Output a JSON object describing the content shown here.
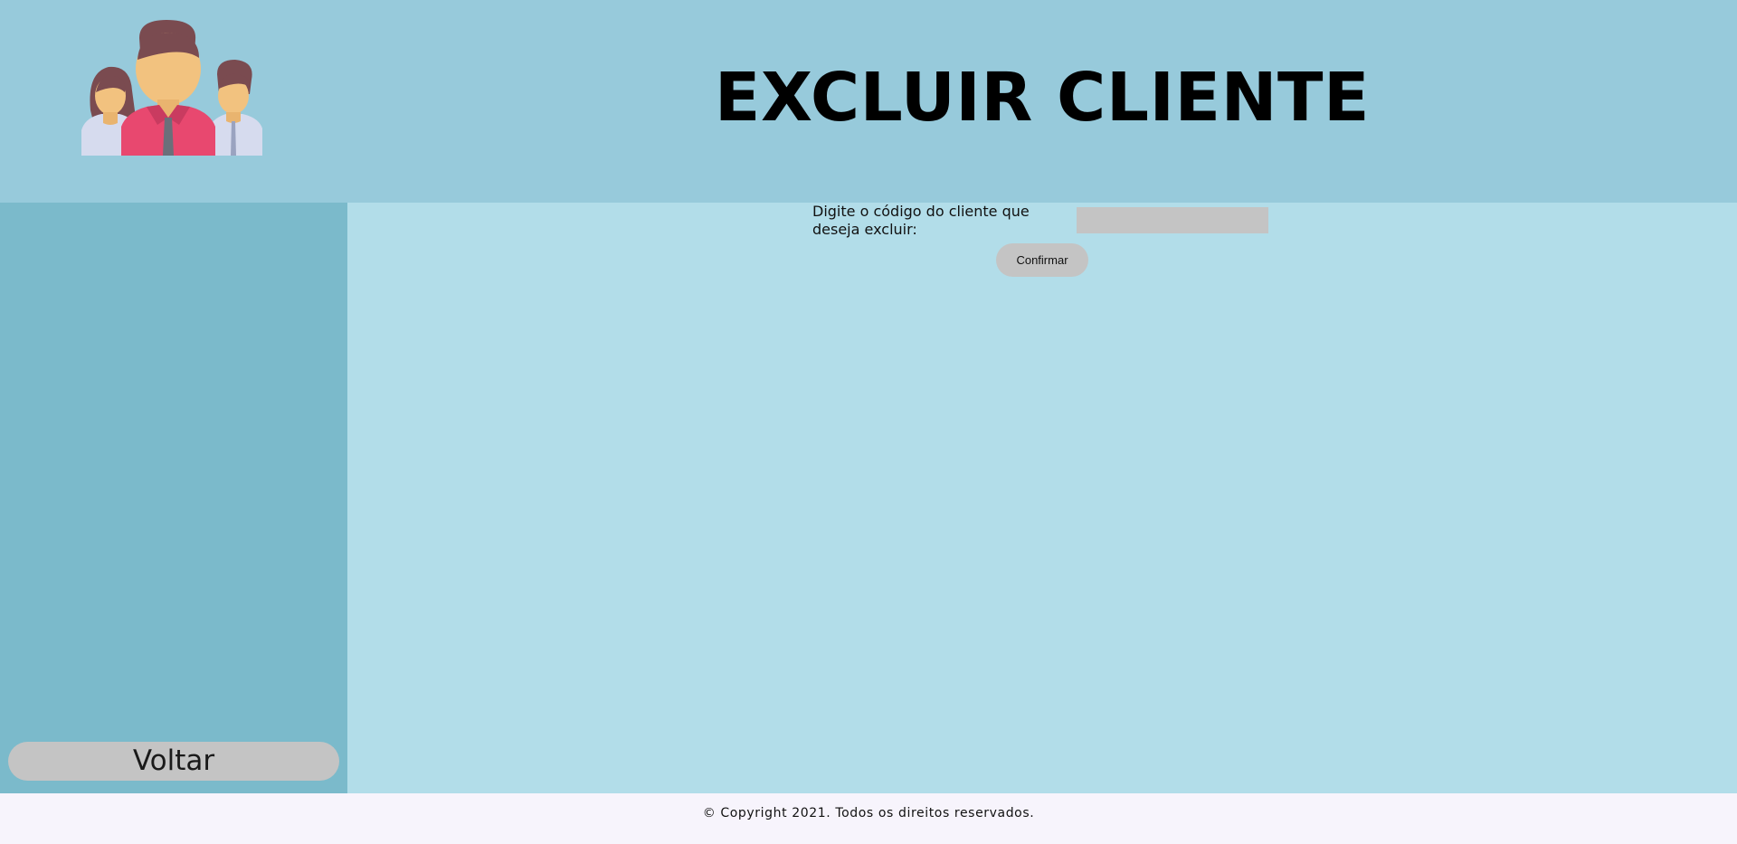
{
  "header": {
    "title": "EXCLUIR CLIENTE",
    "logo_icon": "team-people-icon"
  },
  "sidebar": {
    "back_label": "Voltar"
  },
  "form": {
    "label": "Digite o código do cliente que deseja excluir:",
    "code_value": "",
    "code_placeholder": "",
    "confirm_label": "Confirmar"
  },
  "footer": {
    "copyright": "© Copyright 2021. Todos os direitos reservados."
  },
  "colors": {
    "header_bg": "#97cadb",
    "sidebar_bg": "#7bbacb",
    "main_bg": "#b2dde9",
    "footer_bg": "#f7f4fc",
    "button_bg": "#c4c4c4",
    "accent_shirt": "#e8486f"
  }
}
